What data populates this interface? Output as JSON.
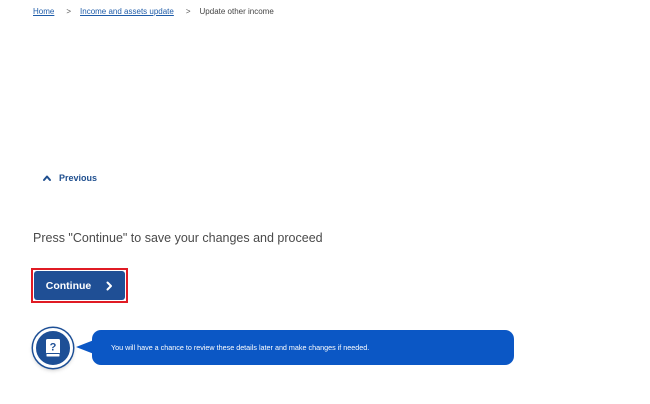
{
  "breadcrumb": {
    "items": [
      {
        "label": "Home"
      },
      {
        "label": "Income and assets update"
      },
      {
        "label": "Update other income"
      }
    ],
    "separator": ">"
  },
  "navigation": {
    "previous_label": "Previous",
    "previous_icon": "chevron-up-icon"
  },
  "main": {
    "instruction": "Press \"Continue\" to save your changes and proceed",
    "continue_label": "Continue",
    "continue_icon": "chevron-right-icon"
  },
  "help": {
    "icon": "question-book-icon",
    "message": "You will have a chance to review these details later and make changes if needed."
  },
  "colors": {
    "primary": "#1f4f95",
    "link": "#1d5ba8",
    "bubble": "#0b57c5",
    "highlight_outline": "#e01b24"
  }
}
